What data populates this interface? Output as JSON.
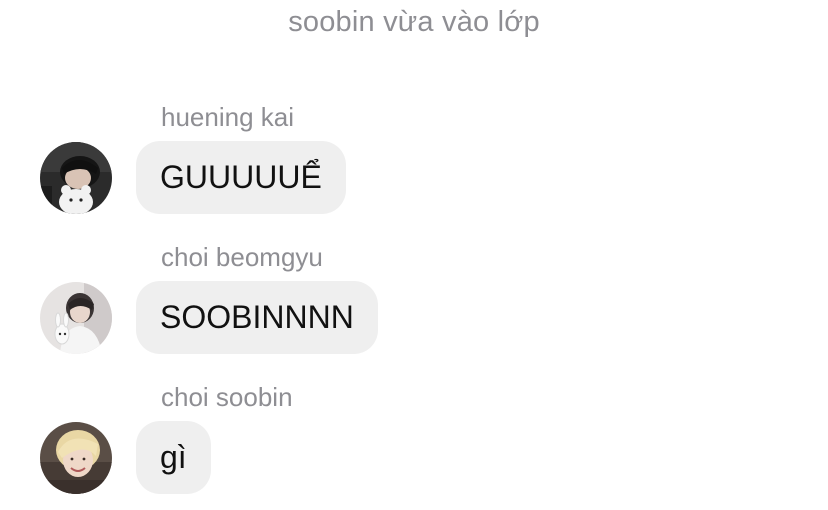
{
  "system_notice": "soobin vừa vào lớp",
  "messages": [
    {
      "sender": "huening kai",
      "text": "GUUUUUỂ",
      "avatar_icon": "user-avatar-dark-photo-icon"
    },
    {
      "sender": "choi beomgyu",
      "text": "SOOBINNNN",
      "avatar_icon": "user-avatar-light-photo-icon"
    },
    {
      "sender": "choi soobin",
      "text": "gì",
      "avatar_icon": "user-avatar-blond-photo-icon"
    }
  ],
  "colors": {
    "bubble_background": "#efefef",
    "secondary_text": "#8e8e93",
    "primary_text": "#111111"
  }
}
